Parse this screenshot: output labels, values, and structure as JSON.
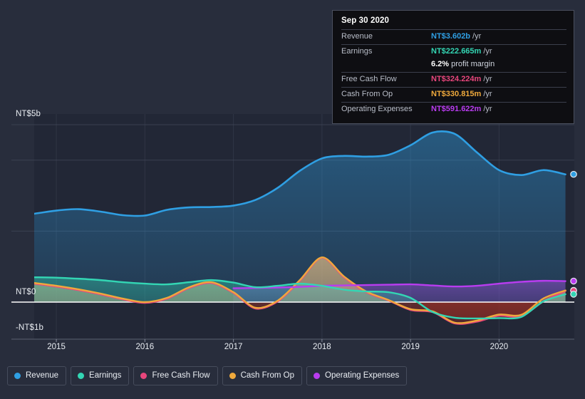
{
  "axes": {
    "y_labels": [
      {
        "text": "NT$5b"
      },
      {
        "text": "NT$0"
      },
      {
        "text": "-NT$1b"
      }
    ],
    "x_labels": [
      "2015",
      "2016",
      "2017",
      "2018",
      "2019",
      "2020"
    ]
  },
  "tooltip": {
    "date": "Sep 30 2020",
    "rows": [
      {
        "label": "Revenue",
        "value": "NT$3.602b",
        "unit": "/yr",
        "color": "#2f9fe3"
      },
      {
        "label": "Earnings",
        "value": "NT$222.665m",
        "unit": "/yr",
        "color": "#33d6b4"
      },
      {
        "label": "",
        "value": "6.2%",
        "sub": "profit margin",
        "color": "#ffffff"
      },
      {
        "label": "Free Cash Flow",
        "value": "NT$324.224m",
        "unit": "/yr",
        "color": "#e8467c"
      },
      {
        "label": "Cash From Op",
        "value": "NT$330.815m",
        "unit": "/yr",
        "color": "#efa93c"
      },
      {
        "label": "Operating Expenses",
        "value": "NT$591.622m",
        "unit": "/yr",
        "color": "#b93cf0"
      }
    ]
  },
  "legend": [
    {
      "label": "Revenue",
      "color": "#2f9fe3"
    },
    {
      "label": "Earnings",
      "color": "#33d6b4"
    },
    {
      "label": "Free Cash Flow",
      "color": "#e8467c"
    },
    {
      "label": "Cash From Op",
      "color": "#efa93c"
    },
    {
      "label": "Operating Expenses",
      "color": "#b93cf0"
    }
  ],
  "colors": {
    "background": "#282d3c",
    "revenue": "#2f9fe3",
    "earnings": "#33d6b4",
    "free_cash_flow": "#e8467c",
    "cash_from_op": "#efa93c",
    "operating_expenses": "#b93cf0",
    "zero_line": "#ffffff",
    "grid": "#414859"
  },
  "chart_data": {
    "type": "area",
    "title": "",
    "xlabel": "",
    "ylabel": "NT$",
    "currency": "NT$",
    "unit": "billions",
    "ylim": [
      -1.05,
      5.0
    ],
    "xlim": [
      2014.75,
      2020.85
    ],
    "grid": true,
    "gridlines_y": [
      5.0,
      4.0,
      2.0,
      0.0
    ],
    "legend_position": "bottom",
    "x": [
      2014.75,
      2015.0,
      2015.25,
      2015.5,
      2015.75,
      2016.0,
      2016.25,
      2016.5,
      2016.75,
      2017.0,
      2017.25,
      2017.5,
      2017.75,
      2018.0,
      2018.25,
      2018.5,
      2018.75,
      2019.0,
      2019.25,
      2019.5,
      2019.75,
      2020.0,
      2020.25,
      2020.5,
      2020.75
    ],
    "series": [
      {
        "name": "Revenue",
        "color": "#2f9fe3",
        "values": [
          2.49,
          2.58,
          2.62,
          2.55,
          2.45,
          2.44,
          2.6,
          2.67,
          2.68,
          2.72,
          2.88,
          3.22,
          3.7,
          4.05,
          4.12,
          4.1,
          4.15,
          4.42,
          4.78,
          4.74,
          4.22,
          3.72,
          3.58,
          3.72,
          3.6
        ]
      },
      {
        "name": "Earnings",
        "color": "#33d6b4",
        "values": [
          0.7,
          0.69,
          0.66,
          0.62,
          0.56,
          0.52,
          0.5,
          0.56,
          0.62,
          0.55,
          0.42,
          0.46,
          0.52,
          0.46,
          0.35,
          0.3,
          0.28,
          0.12,
          -0.28,
          -0.44,
          -0.46,
          -0.45,
          -0.42,
          0.02,
          0.22
        ]
      },
      {
        "name": "Free Cash Flow",
        "color": "#e8467c",
        "values": [
          0.52,
          0.44,
          0.34,
          0.22,
          0.08,
          -0.02,
          0.1,
          0.4,
          0.54,
          0.26,
          -0.18,
          0.02,
          0.6,
          1.25,
          0.7,
          0.28,
          0.05,
          -0.22,
          -0.28,
          -0.6,
          -0.55,
          -0.38,
          -0.4,
          0.02,
          0.32
        ]
      },
      {
        "name": "Cash From Op",
        "color": "#efa93c",
        "values": [
          0.54,
          0.46,
          0.36,
          0.24,
          0.1,
          0.0,
          0.12,
          0.42,
          0.56,
          0.28,
          -0.16,
          0.04,
          0.62,
          1.26,
          0.72,
          0.3,
          0.06,
          -0.2,
          -0.26,
          -0.58,
          -0.52,
          -0.35,
          -0.36,
          0.1,
          0.33
        ]
      },
      {
        "name": "Operating Expenses",
        "color": "#b93cf0",
        "values": [
          null,
          null,
          null,
          null,
          null,
          null,
          null,
          null,
          null,
          0.39,
          0.4,
          0.41,
          0.43,
          0.46,
          0.47,
          0.48,
          0.49,
          0.5,
          0.47,
          0.44,
          0.46,
          0.52,
          0.57,
          0.6,
          0.59
        ]
      }
    ],
    "endpoint_markers": [
      {
        "series": "Revenue",
        "value": 3.602
      },
      {
        "series": "Operating Expenses",
        "value": 0.591622
      },
      {
        "series": "Cash From Op",
        "value": 0.330815
      },
      {
        "series": "Free Cash Flow",
        "value": 0.324224
      },
      {
        "series": "Earnings",
        "value": 0.222665
      }
    ]
  }
}
